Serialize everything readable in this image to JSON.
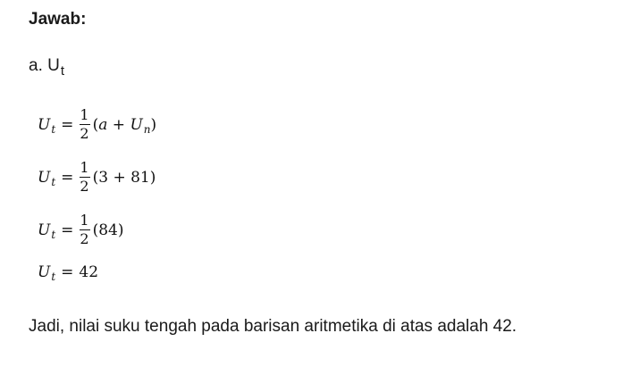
{
  "heading": "Jawab:",
  "subpart": {
    "label": "a. U",
    "subscript": "t"
  },
  "equations": [
    {
      "lhs_var": "U",
      "lhs_sub": "t",
      "eq": "=",
      "frac_num": "1",
      "frac_den": "2",
      "rhs_open": "(",
      "rhs_a": "a",
      "rhs_plus": " + ",
      "rhs_var": "U",
      "rhs_sub": "n",
      "rhs_close": ")"
    },
    {
      "lhs_var": "U",
      "lhs_sub": "t",
      "eq": "=",
      "frac_num": "1",
      "frac_den": "2",
      "rhs": "(3 + 81)"
    },
    {
      "lhs_var": "U",
      "lhs_sub": "t",
      "eq": "=",
      "frac_num": "1",
      "frac_den": "2",
      "rhs": "(84)"
    },
    {
      "lhs_var": "U",
      "lhs_sub": "t",
      "eq": "=",
      "rhs": "42"
    }
  ],
  "conclusion": "Jadi, nilai suku tengah pada barisan aritmetika di atas adalah 42."
}
